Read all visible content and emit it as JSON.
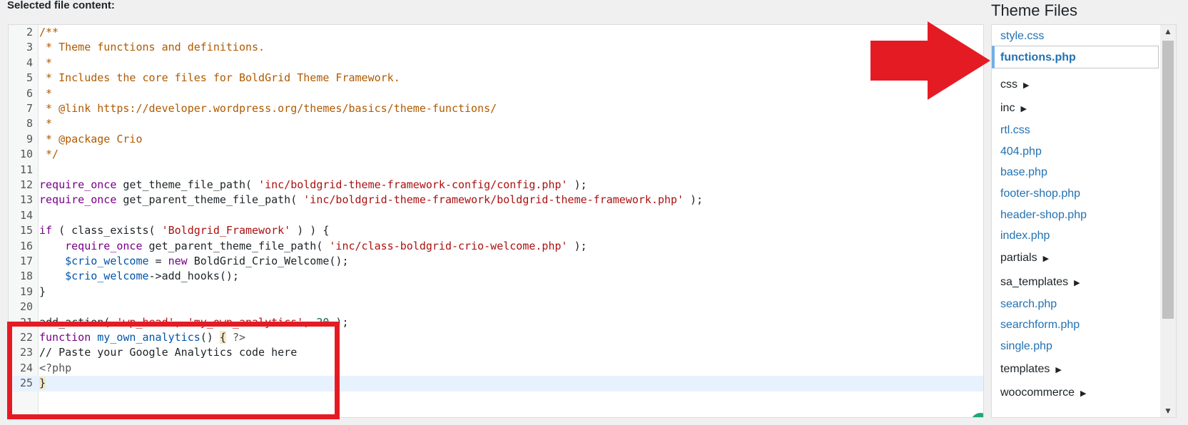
{
  "header": {
    "label": "Selected file content:"
  },
  "editor": {
    "lines": [
      {
        "n": "2",
        "tokens": [
          [
            "c",
            "/**"
          ]
        ]
      },
      {
        "n": "3",
        "tokens": [
          [
            "c",
            " * Theme functions and definitions."
          ]
        ]
      },
      {
        "n": "4",
        "tokens": [
          [
            "c",
            " *"
          ]
        ]
      },
      {
        "n": "5",
        "tokens": [
          [
            "c",
            " * Includes the core files for BoldGrid Theme Framework."
          ]
        ]
      },
      {
        "n": "6",
        "tokens": [
          [
            "c",
            " *"
          ]
        ]
      },
      {
        "n": "7",
        "tokens": [
          [
            "c",
            " * @link https://developer.wordpress.org/themes/basics/theme-functions/"
          ]
        ]
      },
      {
        "n": "8",
        "tokens": [
          [
            "c",
            " *"
          ]
        ]
      },
      {
        "n": "9",
        "tokens": [
          [
            "c",
            " * @package Crio"
          ]
        ]
      },
      {
        "n": "10",
        "tokens": [
          [
            "c",
            " */"
          ]
        ]
      },
      {
        "n": "11",
        "tokens": []
      },
      {
        "n": "12",
        "tokens": [
          [
            "k",
            "require_once"
          ],
          [
            "p",
            " get_theme_file_path( "
          ],
          [
            "s",
            "'inc/boldgrid-theme-framework-config/config.php'"
          ],
          [
            "p",
            " );"
          ]
        ]
      },
      {
        "n": "13",
        "tokens": [
          [
            "k",
            "require_once"
          ],
          [
            "p",
            " get_parent_theme_file_path( "
          ],
          [
            "s",
            "'inc/boldgrid-theme-framework/boldgrid-theme-framework.php'"
          ],
          [
            "p",
            " );"
          ]
        ]
      },
      {
        "n": "14",
        "tokens": []
      },
      {
        "n": "15",
        "tokens": [
          [
            "k",
            "if"
          ],
          [
            "p",
            " ( class_exists( "
          ],
          [
            "s",
            "'Boldgrid_Framework'"
          ],
          [
            "p",
            " ) ) {"
          ]
        ]
      },
      {
        "n": "16",
        "tokens": [
          [
            "p",
            "    "
          ],
          [
            "k",
            "require_once"
          ],
          [
            "p",
            " get_parent_theme_file_path( "
          ],
          [
            "s",
            "'inc/class-boldgrid-crio-welcome.php'"
          ],
          [
            "p",
            " );"
          ]
        ]
      },
      {
        "n": "17",
        "tokens": [
          [
            "p",
            "    "
          ],
          [
            "v",
            "$crio_welcome"
          ],
          [
            "p",
            " = "
          ],
          [
            "k",
            "new"
          ],
          [
            "p",
            " BoldGrid_Crio_Welcome();"
          ]
        ]
      },
      {
        "n": "18",
        "tokens": [
          [
            "p",
            "    "
          ],
          [
            "v",
            "$crio_welcome"
          ],
          [
            "p",
            "->add_hooks();"
          ]
        ]
      },
      {
        "n": "19",
        "tokens": [
          [
            "p",
            "}"
          ]
        ]
      },
      {
        "n": "20",
        "tokens": []
      },
      {
        "n": "21",
        "tokens": [
          [
            "p",
            "add_action( "
          ],
          [
            "s",
            "'wp_head'"
          ],
          [
            "p",
            ", "
          ],
          [
            "s",
            "'my_own_analytics'"
          ],
          [
            "p",
            ", "
          ],
          [
            "n",
            "20"
          ],
          [
            "p",
            " );"
          ]
        ]
      },
      {
        "n": "22",
        "tokens": [
          [
            "k",
            "function"
          ],
          [
            "p",
            " "
          ],
          [
            "d",
            "my_own_analytics"
          ],
          [
            "p",
            "() "
          ],
          [
            "b",
            "{"
          ],
          [
            "p",
            " "
          ],
          [
            "m",
            "?>"
          ]
        ]
      },
      {
        "n": "23",
        "tokens": [
          [
            "p",
            "// Paste your Google Analytics code here"
          ]
        ]
      },
      {
        "n": "24",
        "tokens": [
          [
            "m",
            "<?php"
          ]
        ]
      },
      {
        "n": "25",
        "tokens": [
          [
            "b",
            "}"
          ]
        ]
      }
    ]
  },
  "theme_files": {
    "title": "Theme Files",
    "items": [
      {
        "label": "style.css",
        "type": "file"
      },
      {
        "label": "functions.php",
        "type": "file",
        "current": true
      },
      {
        "label": "css",
        "type": "folder"
      },
      {
        "label": "inc",
        "type": "folder"
      },
      {
        "label": "rtl.css",
        "type": "file"
      },
      {
        "label": "404.php",
        "type": "file"
      },
      {
        "label": "base.php",
        "type": "file"
      },
      {
        "label": "footer-shop.php",
        "type": "file"
      },
      {
        "label": "header-shop.php",
        "type": "file"
      },
      {
        "label": "index.php",
        "type": "file"
      },
      {
        "label": "partials",
        "type": "folder"
      },
      {
        "label": "sa_templates",
        "type": "folder"
      },
      {
        "label": "search.php",
        "type": "file"
      },
      {
        "label": "searchform.php",
        "type": "file"
      },
      {
        "label": "single.php",
        "type": "file"
      },
      {
        "label": "templates",
        "type": "folder"
      },
      {
        "label": "woocommerce",
        "type": "folder"
      }
    ]
  },
  "colors": {
    "annotation_red": "#e51b24",
    "link_blue": "#2271b1",
    "active_marker": "#72aee6"
  },
  "icons": {
    "folder_toggle": "caret-right-icon",
    "scroll_up": "chevron-up-icon",
    "scroll_down": "chevron-down-icon"
  }
}
